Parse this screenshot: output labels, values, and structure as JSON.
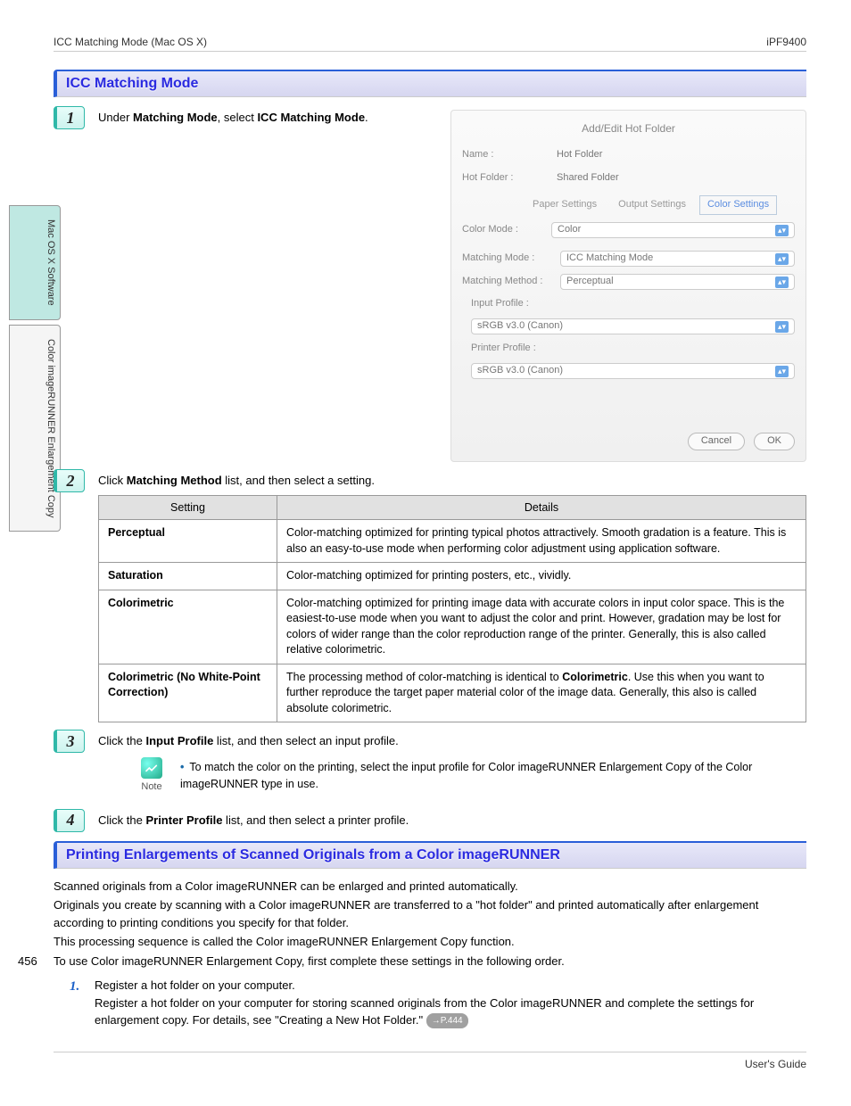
{
  "header": {
    "left": "ICC Matching Mode (Mac OS X)",
    "right": "iPF9400"
  },
  "sideTabs": {
    "tab1": "Mac OS X Software",
    "tab2": "Color imageRUNNER Enlargement Copy"
  },
  "pageNumber": "456",
  "section1": {
    "title": "ICC Matching Mode"
  },
  "step1": {
    "num": "1",
    "text_pre": "Under ",
    "text_b1": "Matching Mode",
    "text_mid": ", select ",
    "text_b2": "ICC Matching Mode",
    "text_post": "."
  },
  "screenshot": {
    "title": "Add/Edit Hot Folder",
    "nameLabel": "Name :",
    "nameValue": "Hot Folder",
    "hotLabel": "Hot Folder :",
    "hotValue": "Shared Folder",
    "tabs": {
      "t1": "Paper Settings",
      "t2": "Output Settings",
      "t3": "Color Settings"
    },
    "colorModeLabel": "Color Mode :",
    "colorModeValue": "Color",
    "matchModeLabel": "Matching Mode :",
    "matchModeValue": "ICC Matching Mode",
    "matchMethodLabel": "Matching Method :",
    "matchMethodValue": "Perceptual",
    "inputProfileLabel": "Input Profile :",
    "inputProfileValue": "sRGB v3.0 (Canon)",
    "printerProfileLabel": "Printer Profile :",
    "printerProfileValue": "sRGB v3.0 (Canon)",
    "cancel": "Cancel",
    "ok": "OK"
  },
  "step2": {
    "num": "2",
    "text_pre": "Click ",
    "text_b": "Matching Method",
    "text_post": " list, and then select a setting."
  },
  "table": {
    "h1": "Setting",
    "h2": "Details",
    "rows": [
      {
        "label": "Perceptual",
        "detail": "Color-matching optimized for printing typical photos attractively. Smooth gradation is a feature. This is also an easy-to-use mode when performing color adjustment using application software."
      },
      {
        "label": "Saturation",
        "detail": "Color-matching optimized for printing posters, etc., vividly."
      },
      {
        "label": "Colorimetric",
        "detail": "Color-matching optimized for printing image data with accurate colors in input color space. This is the easiest-to-use mode when you want to adjust the color and print. However, gradation may be lost for colors of wider range than the color reproduction range of the printer. Generally, this is also called relative colorimetric."
      },
      {
        "label": "Colorimetric (No White-Point Correction)",
        "detail_pre": "The processing method of color-matching is identical to ",
        "detail_b": "Colorimetric",
        "detail_post": ". Use this when you want to further reproduce the target paper material color of the image data. Generally, this also is called absolute colorimetric."
      }
    ]
  },
  "step3": {
    "num": "3",
    "text_pre": "Click the ",
    "text_b": "Input Profile",
    "text_post": " list, and then select an input profile."
  },
  "note3": {
    "label": "Note",
    "bullet": "•",
    "text": "To match the color on the printing, select the input profile for Color imageRUNNER Enlargement Copy of the Color imageRUNNER type in use."
  },
  "step4": {
    "num": "4",
    "text_pre": "Click the ",
    "text_b": "Printer Profile",
    "text_post": " list, and then select a printer profile."
  },
  "section2": {
    "title": "Printing Enlargements of Scanned Originals from a Color imageRUNNER"
  },
  "body": {
    "p1": "Scanned originals from a Color imageRUNNER can be enlarged and printed automatically.",
    "p2": "Originals you create by scanning with a Color imageRUNNER are transferred to a \"hot folder\" and printed automatically after enlargement according to printing conditions you specify for that folder.",
    "p3": "This processing sequence is called the Color imageRUNNER Enlargement Copy function.",
    "p4": "To use Color imageRUNNER Enlargement Copy, first complete these settings in the following order."
  },
  "ol1": {
    "num": "1.",
    "line1": "Register a hot folder on your computer.",
    "line2_pre": "Register a hot folder on your computer for storing scanned originals from the Color imageRUNNER and complete the settings for enlargement copy. For details, see \"Creating a New Hot Folder.\" ",
    "pageref": "→P.444"
  },
  "footer": "User's Guide"
}
